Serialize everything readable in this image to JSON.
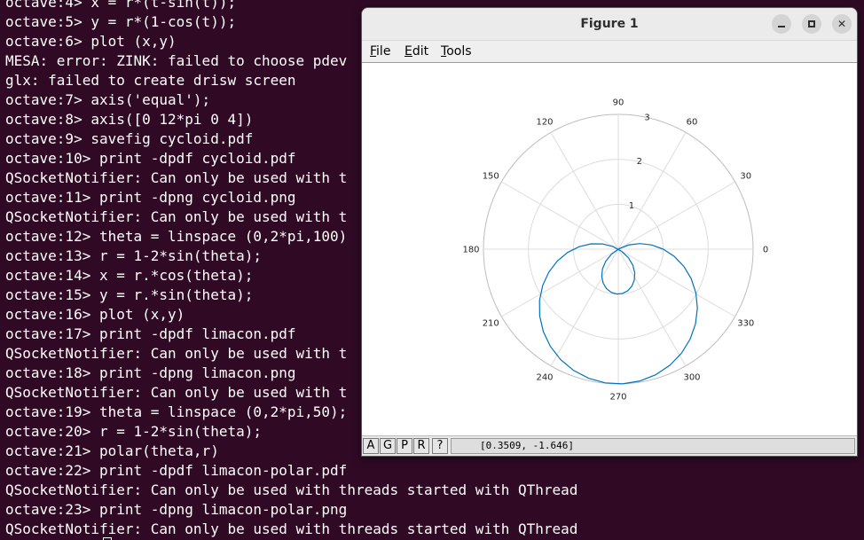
{
  "terminal": {
    "lines": [
      "octave:4> x = r*(t-sin(t));",
      "octave:5> y = r*(1-cos(t));",
      "octave:6> plot (x,y)",
      "MESA: error: ZINK: failed to choose pdev",
      "glx: failed to create drisw screen",
      "octave:7> axis('equal');",
      "octave:8> axis([0 12*pi 0 4])",
      "octave:9> savefig cycloid.pdf",
      "octave:10> print -dpdf cycloid.pdf",
      "QSocketNotifier: Can only be used with t",
      "octave:11> print -dpng cycloid.png",
      "QSocketNotifier: Can only be used with t",
      "octave:12> theta = linspace (0,2*pi,100)",
      "octave:13> r = 1-2*sin(theta);",
      "octave:14> x = r.*cos(theta);",
      "octave:15> y = r.*sin(theta);",
      "octave:16> plot (x,y)",
      "octave:17> print -dpdf limacon.pdf",
      "QSocketNotifier: Can only be used with t",
      "octave:18> print -dpng limacon.png",
      "QSocketNotifier: Can only be used with t",
      "octave:19> theta = linspace (0,2*pi,50);",
      "octave:20> r = 1-2*sin(theta);",
      "octave:21> polar(theta,r)",
      "octave:22> print -dpdf limacon-polar.pdf",
      "QSocketNotifier: Can only be used with threads started with QThread",
      "octave:23> print -dpng limacon-polar.png",
      "QSocketNotifier: Can only be used with threads started with QThread"
    ]
  },
  "figure": {
    "title": "Figure 1",
    "menu": {
      "file": "File",
      "edit": "Edit",
      "tools": "Tools"
    },
    "toolbar": {
      "a": "A",
      "g": "G",
      "p": "P",
      "r": "R",
      "help": "?"
    },
    "coordinate_readout": "[0.3509, -1.646]"
  },
  "colors": {
    "terminal_bg": "#300a24",
    "terminal_fg": "#ffffff",
    "curve": "#0072bd",
    "grid": "#dcdcdc"
  },
  "chart_data": {
    "type": "polar",
    "equation_source": "r = 1-2*sin(theta), theta = linspace(0,2*pi,50)",
    "samples": 50,
    "radial_ticks": [
      "1",
      "2",
      "3"
    ],
    "angle_ticks": [
      "0",
      "30",
      "60",
      "90",
      "120",
      "150",
      "180",
      "210",
      "240",
      "270",
      "300",
      "330"
    ],
    "rmax": 3,
    "series": [
      {
        "color": "#0072bd"
      }
    ]
  }
}
